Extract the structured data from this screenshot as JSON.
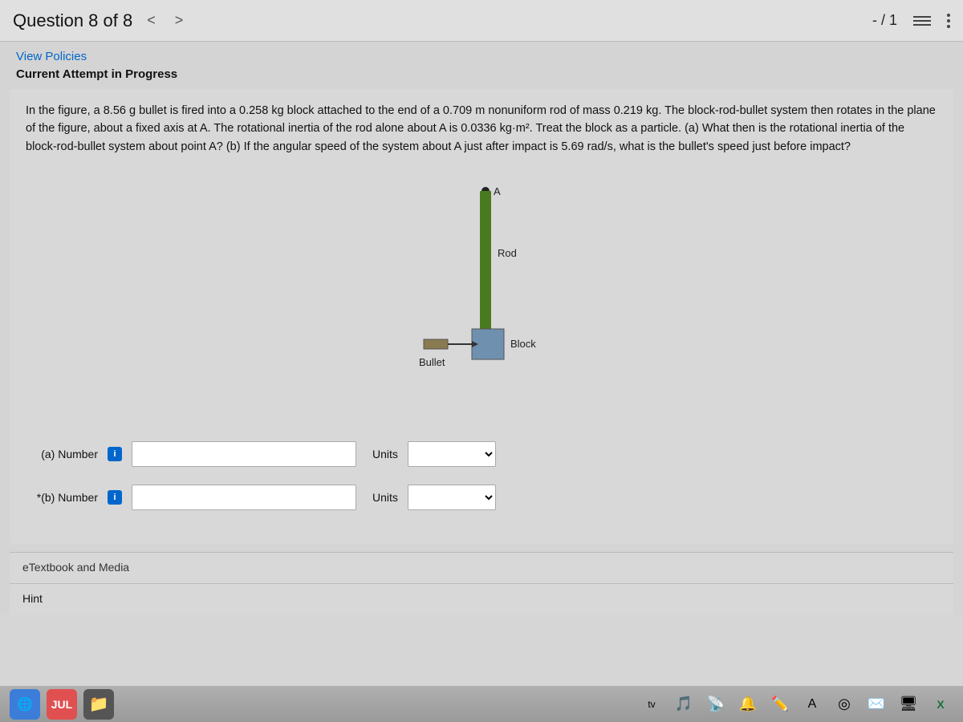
{
  "header": {
    "question_label": "Question 8 of 8",
    "nav_prev": "<",
    "nav_next": ">",
    "score": "- / 1"
  },
  "policies": {
    "link_text": "View Policies"
  },
  "attempt": {
    "label": "Current Attempt in Progress"
  },
  "question": {
    "text": "In the figure, a 8.56 g bullet is fired into a 0.258 kg block attached to the end of a 0.709 m nonuniform rod of mass 0.219 kg. The block-rod-bullet system then rotates in the plane of the figure, about a fixed axis at A. The rotational inertia of the rod alone about A is 0.0336 kg·m². Treat the block as a particle. (a) What then is the rotational inertia of the block-rod-bullet system about point A? (b) If the angular speed of the system about A just after impact is 5.69 rad/s, what is the bullet's speed just before impact?"
  },
  "figure": {
    "labels": {
      "A": "A",
      "rod": "Rod",
      "block": "Block",
      "bullet": "Bullet"
    }
  },
  "answer_a": {
    "part_label": "(a)  Number",
    "info_letter": "i",
    "units_label": "Units",
    "placeholder": "",
    "units_placeholder": ""
  },
  "answer_b": {
    "part_label": "(b)  Number",
    "info_letter": "i",
    "units_label": "Units",
    "placeholder": "",
    "units_placeholder": ""
  },
  "bottom": {
    "etextbook_label": "eTextbook and Media",
    "hint_label": "Hint"
  },
  "taskbar": {
    "jul_label": "JUL",
    "tv_label": "tv"
  }
}
